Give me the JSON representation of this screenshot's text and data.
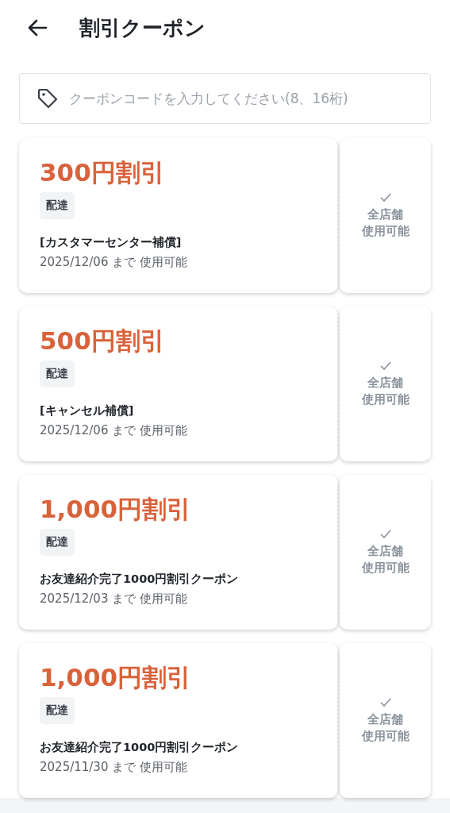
{
  "header": {
    "title": "割引クーポン"
  },
  "search": {
    "placeholder": "クーポンコードを入力してください(8、16桁)"
  },
  "coupons": [
    {
      "amount": "300円割引",
      "tag": "配達",
      "name": "[カスタマーセンター補償]",
      "expiry": "2025/12/06 まで 使用可能",
      "scope": [
        "全店舗",
        "使用可能"
      ]
    },
    {
      "amount": "500円割引",
      "tag": "配達",
      "name": "[キャンセル補償]",
      "expiry": "2025/12/06 まで 使用可能",
      "scope": [
        "全店舗",
        "使用可能"
      ]
    },
    {
      "amount": "1,000円割引",
      "tag": "配達",
      "name": "お友達紹介完了1000円割引クーポン",
      "expiry": "2025/12/03 まで 使用可能",
      "scope": [
        "全店舗",
        "使用可能"
      ]
    },
    {
      "amount": "1,000円割引",
      "tag": "配達",
      "name": "お友達紹介完了1000円割引クーポン",
      "expiry": "2025/11/30 まで 使用可能",
      "scope": [
        "全店舗",
        "使用可能"
      ]
    }
  ]
}
